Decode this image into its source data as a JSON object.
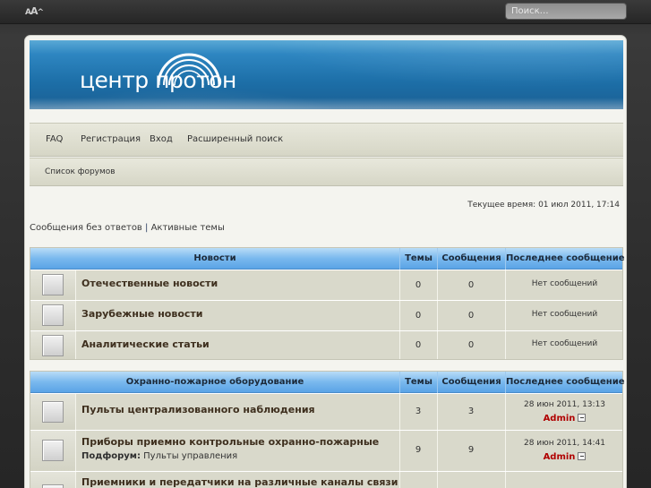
{
  "topbar": {
    "font_size_label": "A",
    "font_size_label_small": "A",
    "font_size_caret": "^",
    "search_placeholder": "Поиск…"
  },
  "logo": {
    "part1": "центр",
    "part2": "протон"
  },
  "nav": {
    "faq": "FAQ",
    "register": "Регистрация",
    "login": "Вход",
    "advanced_search": "Расширенный поиск",
    "forum_list": "Список форумов"
  },
  "current_time": "Текущее время: 01 июл 2011, 17:14",
  "quicklinks": {
    "unanswered": "Сообщения без ответов",
    "separator": " | ",
    "active": "Активные темы"
  },
  "categories": [
    {
      "name": "Новости",
      "col_topics": "Темы",
      "col_posts": "Сообщения",
      "col_last": "Последнее сообщение",
      "forums": [
        {
          "title": "Отечественные новости",
          "topics": "0",
          "posts": "0",
          "last": "Нет сообщений"
        },
        {
          "title": "Зарубежные новости",
          "topics": "0",
          "posts": "0",
          "last": "Нет сообщений"
        },
        {
          "title": "Аналитические статьи",
          "topics": "0",
          "posts": "0",
          "last": "Нет сообщений"
        }
      ]
    },
    {
      "name": "Охранно-пожарное оборудование",
      "col_topics": "Темы",
      "col_posts": "Сообщения",
      "col_last": "Последнее сообщение",
      "forums": [
        {
          "title": "Пульты централизованного наблюдения",
          "topics": "3",
          "posts": "3",
          "last_date": "28 июн 2011, 13:13",
          "last_author": "Admin"
        },
        {
          "title": "Приборы приемно контрольные охранно-пожарные",
          "subforum_label": "Подфорум:",
          "subforum_name": "Пульты управления",
          "topics": "9",
          "posts": "9",
          "last_date": "28 июн 2011, 14:41",
          "last_author": "Admin"
        },
        {
          "title": "Приемники и передатчики на различные каналы связи"
        }
      ]
    }
  ],
  "colors": {
    "header_blue": "#1d6fa8",
    "table_head_blue": "#7ab9ee",
    "author_red": "#b00000"
  }
}
